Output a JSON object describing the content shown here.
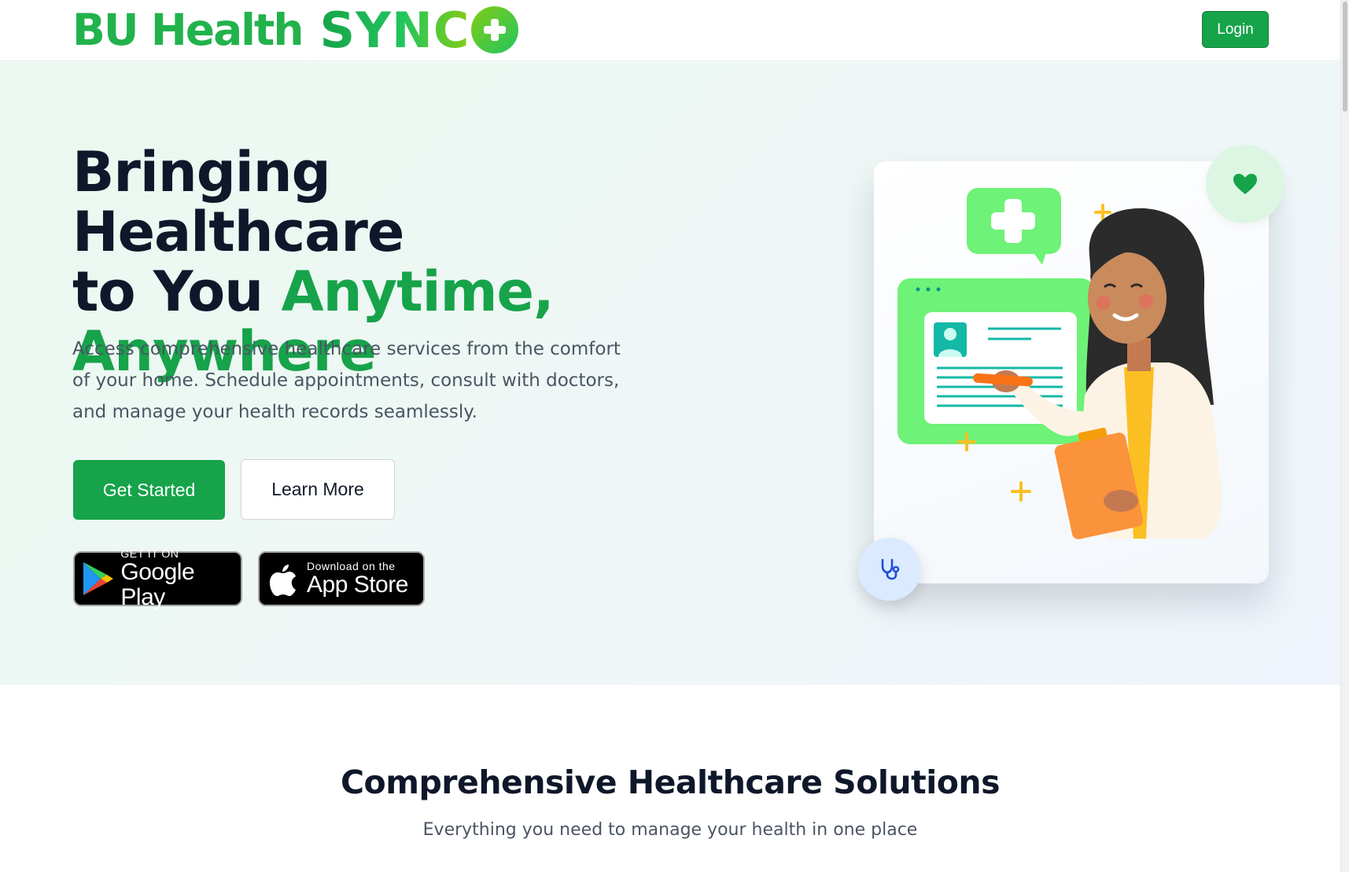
{
  "header": {
    "brand_part1": "BU Health",
    "brand_part2": "SYNC",
    "login_label": "Login"
  },
  "hero": {
    "title_line1": "Bringing Healthcare",
    "title_line2_plain": "to You ",
    "title_line2_accent": "Anytime,",
    "title_line3_accent": "Anywhere",
    "description": "Access comprehensive healthcare services from the comfort of your home. Schedule appointments, consult with doctors, and manage your health records seamlessly.",
    "primary_button": "Get Started",
    "secondary_button": "Learn More",
    "google_play": {
      "small": "GET IT ON",
      "big": "Google Play"
    },
    "app_store": {
      "small": "Download on the",
      "big": "App Store"
    }
  },
  "solutions": {
    "title": "Comprehensive Healthcare Solutions",
    "subtitle": "Everything you need to manage your health in one place"
  },
  "colors": {
    "brand_green": "#16a34a",
    "heading": "#0f172a",
    "body_text": "#4b5563"
  },
  "icons": [
    "plus-circle-icon",
    "google-play-icon",
    "apple-icon",
    "heart-icon",
    "stethoscope-icon"
  ]
}
